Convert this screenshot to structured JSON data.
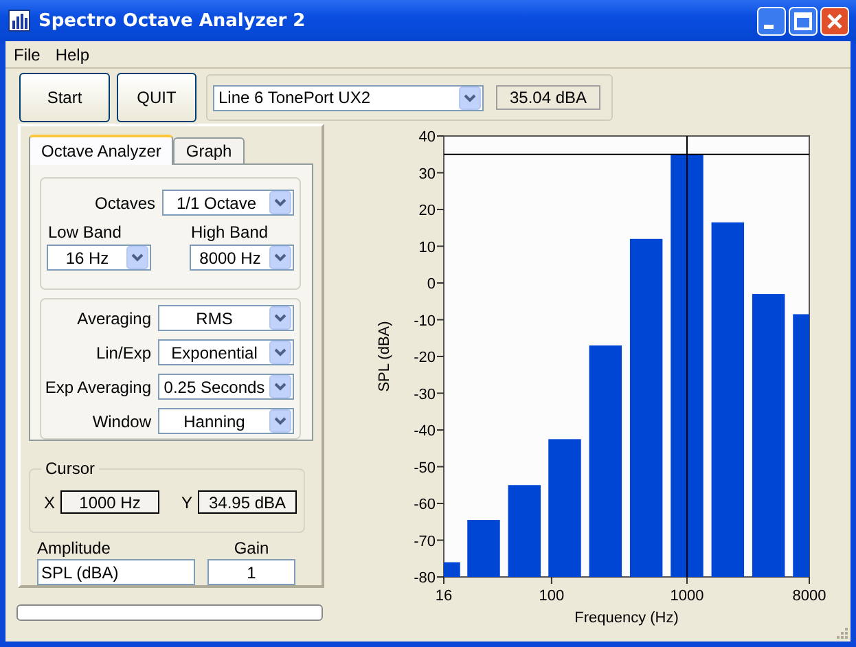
{
  "window": {
    "title": "Spectro Octave Analyzer 2"
  },
  "menu": [
    {
      "label": "File"
    },
    {
      "label": "Help"
    }
  ],
  "toolbar": {
    "buttons": [
      "Start",
      "QUIT"
    ],
    "device": {
      "value": "Line 6 TonePort UX2"
    },
    "level_readout": "35.04 dBA"
  },
  "tabs": [
    {
      "label": "Octave Analyzer",
      "selected": true
    },
    {
      "label": "Graph",
      "selected": false
    }
  ],
  "octaves": {
    "label": "Octaves",
    "value": "1/1 Octave"
  },
  "bands": [
    {
      "label": "Low Band",
      "value": "16 Hz"
    },
    {
      "label": "High Band",
      "value": "8000 Hz"
    }
  ],
  "averaging_settings": [
    {
      "label": "Averaging",
      "value": "RMS"
    },
    {
      "label": "Lin/Exp",
      "value": "Exponential"
    },
    {
      "label": "Exp Averaging",
      "value": "0.25 Seconds"
    },
    {
      "label": "Window",
      "value": "Hanning"
    }
  ],
  "cursor": {
    "title": "Cursor",
    "x_label": "X",
    "x_value": "1000 Hz",
    "y_label": "Y",
    "y_value": "34.95 dBA"
  },
  "amplitude": {
    "label": "Amplitude",
    "value": "SPL (dBA)"
  },
  "gain": {
    "label": "Gain",
    "value": "1"
  },
  "progress": {
    "level": 0
  },
  "graph": {
    "x_axis_title": "Frequency (Hz)",
    "y_axis_title": "SPL (dBA)",
    "y_tick_labels": [
      "40",
      "30",
      "20",
      "10",
      "0",
      "-10",
      "-20",
      "-30",
      "-40",
      "-50",
      "-60",
      "-70",
      "-80"
    ],
    "x_tick_labels": [
      "16",
      "100",
      "1000",
      "8000"
    ]
  }
}
